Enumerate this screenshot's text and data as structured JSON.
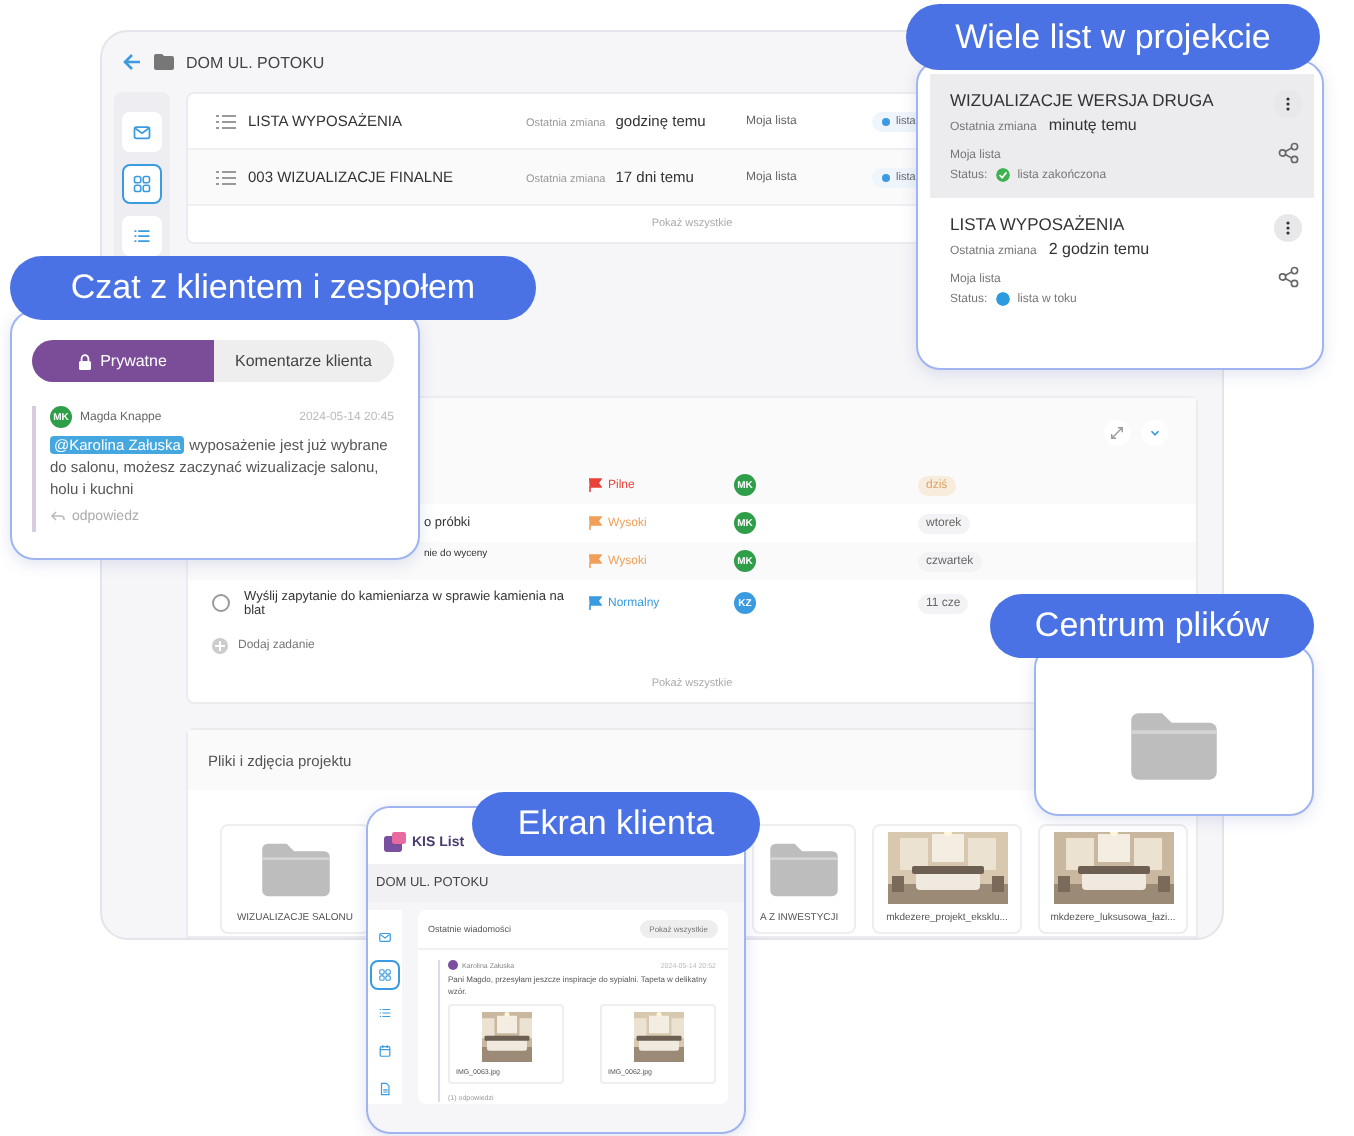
{
  "app": {
    "title": "DOM UL. POTOKU",
    "sidebar": [
      {
        "kind": "mail",
        "selected": false
      },
      {
        "kind": "grid",
        "selected": true
      },
      {
        "kind": "list",
        "selected": false
      }
    ],
    "lists": {
      "items": [
        {
          "name": "LISTA WYPOSAŻENIA",
          "changed_label": "Ostatnia zmiana",
          "changed": "godzinę temu",
          "owner": "Moja lista",
          "status": {
            "label": "lista",
            "color": "#3b9ae1"
          }
        },
        {
          "name": "003 WIZUALIZACJE FINALNE",
          "changed_label": "Ostatnia zmiana",
          "changed": "17 dni temu",
          "owner": "Moja lista",
          "status": {
            "label": "lista",
            "color": "#3b9ae1"
          }
        }
      ],
      "more": "Pokaż wszystkie"
    },
    "tasks": {
      "rows": [
        {
          "kind": "covered",
          "priority": {
            "label": "Pilne",
            "color": "#e8423a"
          },
          "assignee": {
            "initials": "MK",
            "color": "#2e9e48"
          },
          "due": "dziś",
          "today": true
        },
        {
          "kind": "covered",
          "name": "o próbki",
          "priority": {
            "label": "Wysoki",
            "color": "#f0a05a"
          },
          "assignee": {
            "initials": "MK",
            "color": "#2e9e48"
          },
          "due": "wtorek",
          "today": false
        },
        {
          "kind": "covered",
          "name": "nie do wyceny",
          "priority": {
            "label": "Wysoki",
            "color": "#f0a05a"
          },
          "assignee": {
            "initials": "MK",
            "color": "#2e9e48"
          },
          "due": "czwartek",
          "today": false
        },
        {
          "kind": "task",
          "name": "Wyślij zapytanie do kamieniarza w sprawie kamienia na blat",
          "done": false,
          "priority": {
            "label": "Normalny",
            "color": "#3a9be0"
          },
          "assignee": {
            "initials": "KZ",
            "color": "#3a9be0"
          },
          "due": "11 cze",
          "today": false
        }
      ],
      "add": "Dodaj zadanie",
      "more": "Pokaż wszystkie"
    },
    "files": {
      "title": "Pliki i zdjęcia projektu",
      "items": [
        {
          "kind": "folder",
          "name": "WIZUALIZACJE SALONU"
        },
        {
          "kind": "folder",
          "name": "A Z INWESTYCJI"
        },
        {
          "kind": "picture",
          "name": "mkdezere_projekt_eksklu..."
        },
        {
          "kind": "picture",
          "name": "mkdezere_luksusowa_łazi..."
        }
      ]
    }
  },
  "lists_callout": {
    "label": "Wiele list w projekcie",
    "items": [
      {
        "name": "WIZUALIZACJE WERSJA DRUGA",
        "changed_label": "Ostatnia zmiana",
        "changed": "minutę temu",
        "owner": "Moja lista",
        "status_label": "Status:",
        "status": {
          "label": "lista zakończona",
          "kind": "done",
          "color": "#3fb24f"
        },
        "selected": true
      },
      {
        "name": "LISTA WYPOSAŻENIA",
        "changed_label": "Ostatnia zmiana",
        "changed": "2 godzin temu",
        "owner": "Moja lista",
        "status_label": "Status:",
        "status": {
          "label": "lista w toku",
          "kind": "progress",
          "color": "#2d9be0"
        },
        "selected": false
      }
    ]
  },
  "chat_callout": {
    "label": "Czat z klientem i zespołem",
    "tabs": [
      {
        "label": "Prywatne",
        "kind": "private",
        "selected": true
      },
      {
        "label": "Komentarze klienta",
        "kind": "client",
        "selected": false
      }
    ],
    "message": {
      "avatar": {
        "initials": "MK",
        "color": "#2e9e48"
      },
      "author": "Magda Knappe",
      "time": "2024-05-14 20:45",
      "mention": "@Karolina Załuska",
      "text": "wyposażenie jest już wybrane do salonu, możesz zaczynać wizualizacje salonu, holu i kuchni",
      "reply": "odpowiedz"
    }
  },
  "files_callout": {
    "label": "Centrum plików"
  },
  "client_callout": {
    "label": "Ekran klienta",
    "logo": "KIS List",
    "title": "DOM UL. POTOKU",
    "sidebar": [
      {
        "kind": "mail",
        "selected": false
      },
      {
        "kind": "grid",
        "selected": true
      },
      {
        "kind": "list",
        "selected": false
      },
      {
        "kind": "calendar",
        "selected": false
      },
      {
        "kind": "file",
        "selected": false
      }
    ],
    "panel_title": "Ostatnie wiadomości",
    "button": "Pokaż wszystkie",
    "message": {
      "avatar": {
        "color": "#7a4fa0"
      },
      "author": "Karolina Załuska",
      "time": "2024-05-14 20:52",
      "text": "Pani Magdo, przesyłam jeszcze inspiracje do sypialni. Tapeta w delikatny wzór.",
      "attachments": [
        "IMG_0063.jpg",
        "IMG_0062.jpg"
      ],
      "replies": "(1) odpowiedzi"
    }
  }
}
